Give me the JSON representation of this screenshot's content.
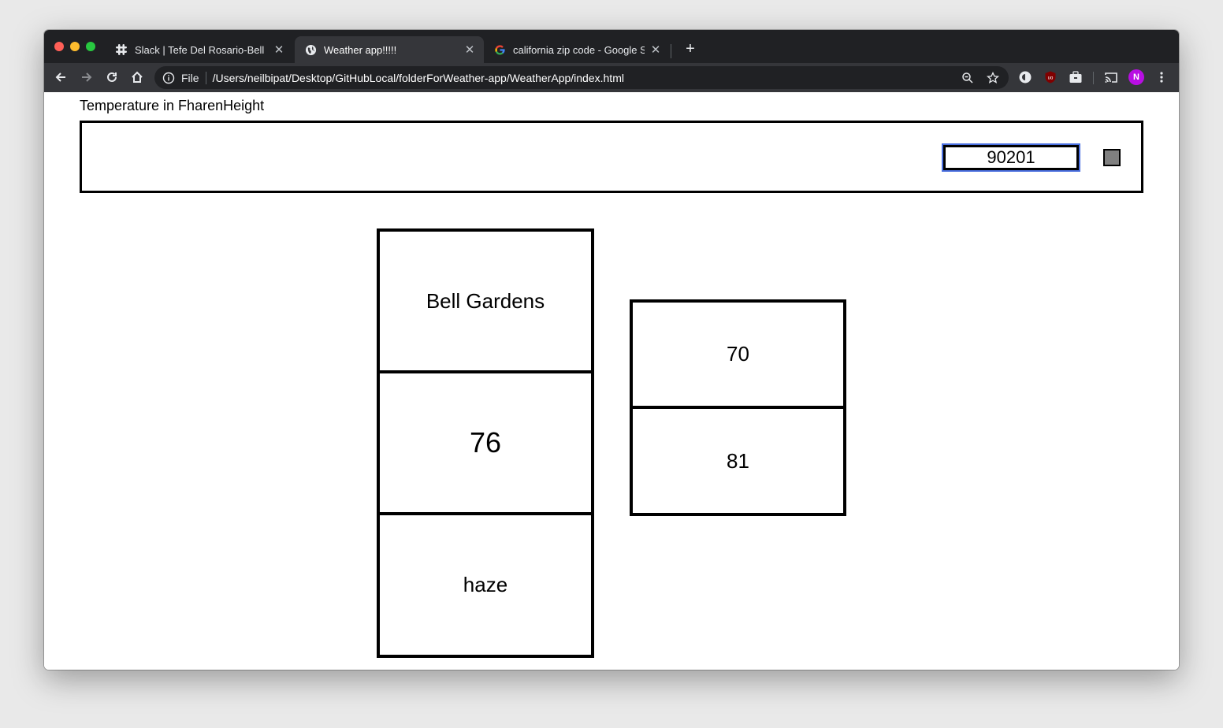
{
  "browser": {
    "tabs": [
      {
        "title": "Slack | Tefe Del Rosario-Bell | (",
        "favicon": "slack-icon",
        "active": false
      },
      {
        "title": "Weather app!!!!!",
        "favicon": "globe-icon",
        "active": true
      },
      {
        "title": "california zip code - Google Se",
        "favicon": "google-icon",
        "active": false
      }
    ],
    "address": {
      "scheme_label": "File",
      "url": "/Users/neilbipat/Desktop/GitHubLocal/folderForWeather-app/WeatherApp/index.html"
    },
    "profile_initial": "N",
    "colors": {
      "tabstrip": "#202124",
      "toolbar": "#35363a",
      "avatar": "#b80ee3"
    }
  },
  "page": {
    "heading": "Temperature in FharenHeight",
    "zip_input": {
      "value": "90201"
    },
    "weather": {
      "city": "Bell Gardens",
      "temperature": "76",
      "description": "haze",
      "low": "70",
      "high": "81"
    }
  }
}
